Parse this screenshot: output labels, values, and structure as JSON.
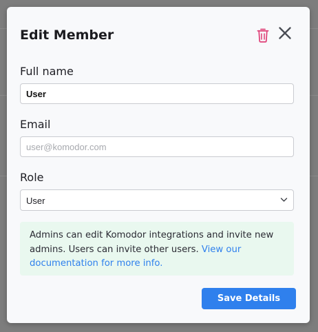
{
  "modal": {
    "title": "Edit Member",
    "icons": {
      "delete": "trash-icon",
      "close": "close-icon"
    },
    "colors": {
      "delete_icon": "#e0457b",
      "primary": "#2f80ed",
      "info_bg": "#e9f8ef"
    }
  },
  "form": {
    "full_name": {
      "label": "Full name",
      "value": "User"
    },
    "email": {
      "label": "Email",
      "value": "",
      "placeholder": "user@komodor.com"
    },
    "role": {
      "label": "Role",
      "selected": "User"
    }
  },
  "info": {
    "text": "Admins can edit Komodor integrations and invite new admins. Users can invite other users.",
    "link": "View our documentation for more info."
  },
  "actions": {
    "save_label": "Save Details"
  }
}
